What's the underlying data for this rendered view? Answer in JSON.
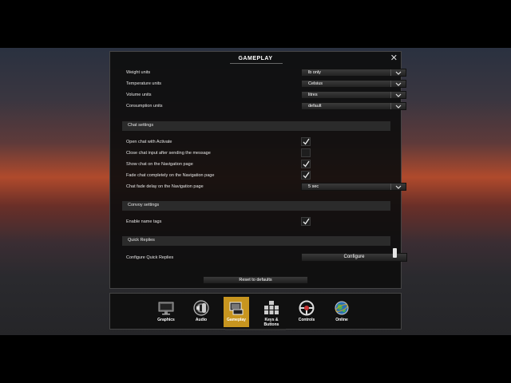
{
  "window_title": "GAMEPLAY",
  "close_label": "✕",
  "units": [
    {
      "label": "Weight units",
      "value": "lb only"
    },
    {
      "label": "Temperature units",
      "value": "Celsius"
    },
    {
      "label": "Volume units",
      "value": "litres"
    },
    {
      "label": "Consumption units",
      "value": "default"
    }
  ],
  "chat": {
    "header": "Chat settings",
    "open_chat": {
      "label": "Open chat with Activate",
      "checked": true
    },
    "close_chat": {
      "label": "Close chat input after sending the message",
      "checked": false
    },
    "show_chat": {
      "label": "Show chat on the Navigation page",
      "checked": true
    },
    "fade_chat": {
      "label": "Fade chat completely on the Navigation page",
      "checked": true
    },
    "fade_delay": {
      "label": "Chat fade delay on the Navigation page",
      "value": "5 sec"
    }
  },
  "convoy": {
    "header": "Convoy settings",
    "name_tags": {
      "label": "Enable name tags",
      "checked": true
    }
  },
  "quick_replies": {
    "header": "Quick Replies",
    "configure_label": "Configure Quick Replies",
    "configure_button": "Configure"
  },
  "reset_label": "Reset to defaults",
  "categories": [
    {
      "label": "Graphics",
      "icon": "monitor-icon",
      "active": false
    },
    {
      "label": "Audio",
      "icon": "speaker-icon",
      "active": false
    },
    {
      "label": "Gameplay",
      "icon": "gameplay-icon",
      "active": true
    },
    {
      "label": "Keys &\nButtons",
      "icon": "keyboard-icon",
      "active": false
    },
    {
      "label": "Controls",
      "icon": "steering-wheel-icon",
      "active": false
    },
    {
      "label": "Online",
      "icon": "globe-icon",
      "active": false
    }
  ],
  "colors": {
    "active_category": "#c7951f",
    "panel_bg": "#0e0e0e",
    "section_bg": "#2b2b2b"
  }
}
